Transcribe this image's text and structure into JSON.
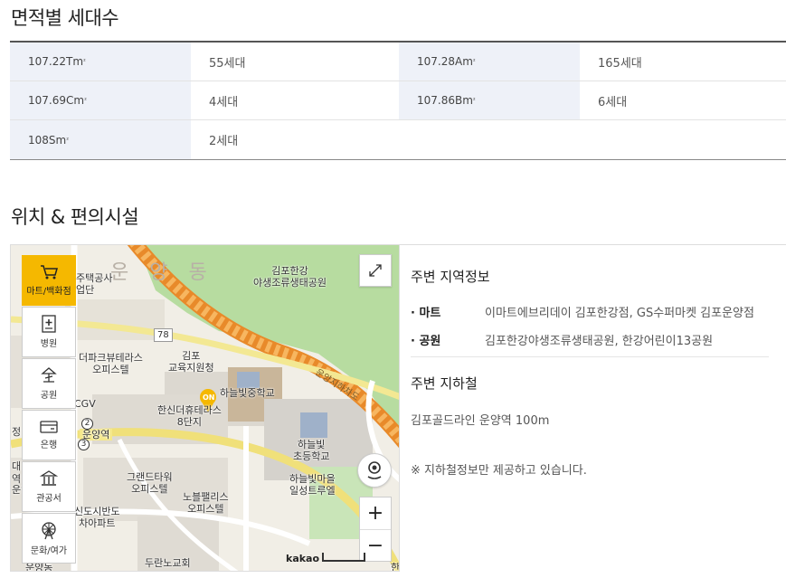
{
  "sections": {
    "area_title": "면적별 세대수",
    "location_title": "위치 & 편의시설"
  },
  "area_table": {
    "rows": [
      [
        {
          "type": "107.22Tm",
          "sup": "²",
          "count": "55세대"
        },
        {
          "type": "107.28Am",
          "sup": "²",
          "count": "165세대"
        }
      ],
      [
        {
          "type": "107.69Cm",
          "sup": "²",
          "count": "4세대"
        },
        {
          "type": "107.86Bm",
          "sup": "²",
          "count": "6세대"
        }
      ],
      [
        {
          "type": "108Sm",
          "sup": "²",
          "count": "2세대"
        }
      ]
    ]
  },
  "map": {
    "categories": [
      {
        "label": "마트/백화점",
        "icon": "cart-icon",
        "active": true
      },
      {
        "label": "병원",
        "icon": "hospital-icon",
        "active": false
      },
      {
        "label": "공원",
        "icon": "park-icon",
        "active": false
      },
      {
        "label": "은행",
        "icon": "bank-card-icon",
        "active": false
      },
      {
        "label": "관공서",
        "icon": "government-building-icon",
        "active": false
      },
      {
        "label": "문화/여가",
        "icon": "ferris-wheel-icon",
        "active": false
      }
    ],
    "labels": {
      "park": "김포한강\n야생조류생태공원",
      "district": "운 양 동",
      "housing": "주택공사\n업단",
      "terrace": "더파크뷰테라스\n오피스텔",
      "education": "김포\n교육지원청",
      "school_mid": "하늘빛중학교",
      "hansin": "한신더휴테라스\n8단지",
      "cgv": "CGV",
      "elementary": "하늘빛\n초등학교",
      "grand": "그랜드타워\n오피스텔",
      "nobel": "노블팰리스\n오피스텔",
      "haneul_village": "하늘빛마을\n일성트루엘",
      "shindo": "신도시반도\n차아파트",
      "duran": "두란노교회",
      "road78": "78",
      "station": "운양역",
      "road_name": "운양지하차도",
      "jeong": "정",
      "dae": "대",
      "yeok": "역",
      "unyang_short": "운양",
      "bottom_cut": "운양동",
      "bottom_right": "한",
      "marker": "ON",
      "badge2": "2",
      "badge3": "3",
      "brand": "kakao"
    },
    "zoom_in": "+",
    "zoom_out": "−"
  },
  "info": {
    "area_heading": "주변 지역정보",
    "items": [
      {
        "key": "· 마트",
        "value": "이마트에브리데이 김포한강점, GS수퍼마켓 김포운양점"
      },
      {
        "key": "· 공원",
        "value": "김포한강야생조류생태공원, 한강어린이13공원"
      }
    ],
    "subway_heading": "주변 지하철",
    "subway": "김포골드라인 운양역 100m",
    "note": "※ 지하철정보만 제공하고 있습니다."
  },
  "colors": {
    "accent": "#f5b800",
    "table_label_bg": "#eef1f8",
    "park_green": "#b7dca0",
    "road_orange": "#f0a04a"
  }
}
